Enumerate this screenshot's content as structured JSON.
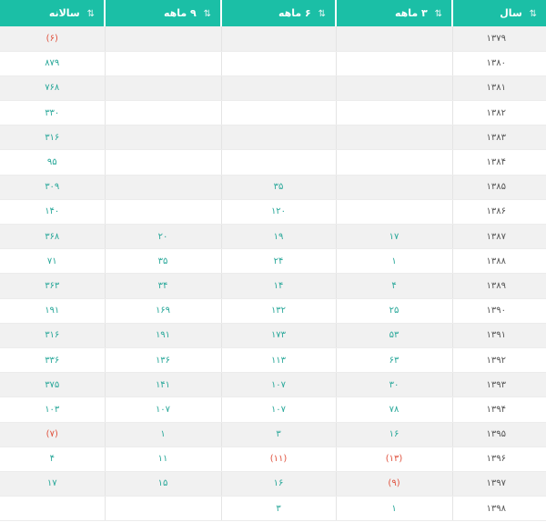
{
  "colors": {
    "header_bg": "#1bbfa6",
    "value": "#2aa89a",
    "negative": "#e0533f",
    "year_text": "#555555"
  },
  "icons": {
    "sort": "sort-icon"
  },
  "headers": {
    "year": "سال",
    "three_month": "۳ ماهه",
    "six_month": "۶ ماهه",
    "nine_month": "۹ ماهه",
    "annual": "سالانه",
    "sort_glyph": "⇅"
  },
  "rows": [
    {
      "year": "۱۳۷۹",
      "m3": "",
      "m6": "",
      "m9": "",
      "annual": "(۶)",
      "neg": [
        "annual"
      ]
    },
    {
      "year": "۱۳۸۰",
      "m3": "",
      "m6": "",
      "m9": "",
      "annual": "۸۷۹",
      "neg": []
    },
    {
      "year": "۱۳۸۱",
      "m3": "",
      "m6": "",
      "m9": "",
      "annual": "۷۶۸",
      "neg": []
    },
    {
      "year": "۱۳۸۲",
      "m3": "",
      "m6": "",
      "m9": "",
      "annual": "۳۳۰",
      "neg": []
    },
    {
      "year": "۱۳۸۳",
      "m3": "",
      "m6": "",
      "m9": "",
      "annual": "۳۱۶",
      "neg": []
    },
    {
      "year": "۱۳۸۴",
      "m3": "",
      "m6": "",
      "m9": "",
      "annual": "۹۵",
      "neg": []
    },
    {
      "year": "۱۳۸۵",
      "m3": "",
      "m6": "۳۵",
      "m9": "",
      "annual": "۳۰۹",
      "neg": []
    },
    {
      "year": "۱۳۸۶",
      "m3": "",
      "m6": "۱۲۰",
      "m9": "",
      "annual": "۱۴۰",
      "neg": []
    },
    {
      "year": "۱۳۸۷",
      "m3": "۱۷",
      "m6": "۱۹",
      "m9": "۲۰",
      "annual": "۳۶۸",
      "neg": []
    },
    {
      "year": "۱۳۸۸",
      "m3": "۱",
      "m6": "۲۴",
      "m9": "۳۵",
      "annual": "۷۱",
      "neg": []
    },
    {
      "year": "۱۳۸۹",
      "m3": "۴",
      "m6": "۱۴",
      "m9": "۳۴",
      "annual": "۳۶۳",
      "neg": []
    },
    {
      "year": "۱۳۹۰",
      "m3": "۲۵",
      "m6": "۱۳۲",
      "m9": "۱۶۹",
      "annual": "۱۹۱",
      "neg": []
    },
    {
      "year": "۱۳۹۱",
      "m3": "۵۳",
      "m6": "۱۷۳",
      "m9": "۱۹۱",
      "annual": "۳۱۶",
      "neg": []
    },
    {
      "year": "۱۳۹۲",
      "m3": "۶۳",
      "m6": "۱۱۳",
      "m9": "۱۳۶",
      "annual": "۳۳۶",
      "neg": []
    },
    {
      "year": "۱۳۹۳",
      "m3": "۳۰",
      "m6": "۱۰۷",
      "m9": "۱۴۱",
      "annual": "۳۷۵",
      "neg": []
    },
    {
      "year": "۱۳۹۴",
      "m3": "۷۸",
      "m6": "۱۰۷",
      "m9": "۱۰۷",
      "annual": "۱۰۳",
      "neg": []
    },
    {
      "year": "۱۳۹۵",
      "m3": "۱۶",
      "m6": "۳",
      "m9": "۱",
      "annual": "(۷)",
      "neg": [
        "annual"
      ]
    },
    {
      "year": "۱۳۹۶",
      "m3": "(۱۳)",
      "m6": "(۱۱)",
      "m9": "۱۱",
      "annual": "۴",
      "neg": [
        "m3",
        "m6"
      ]
    },
    {
      "year": "۱۳۹۷",
      "m3": "(۹)",
      "m6": "۱۶",
      "m9": "۱۵",
      "annual": "۱۷",
      "neg": [
        "m3"
      ]
    },
    {
      "year": "۱۳۹۸",
      "m3": "۱",
      "m6": "۳",
      "m9": "",
      "annual": "",
      "neg": []
    }
  ]
}
